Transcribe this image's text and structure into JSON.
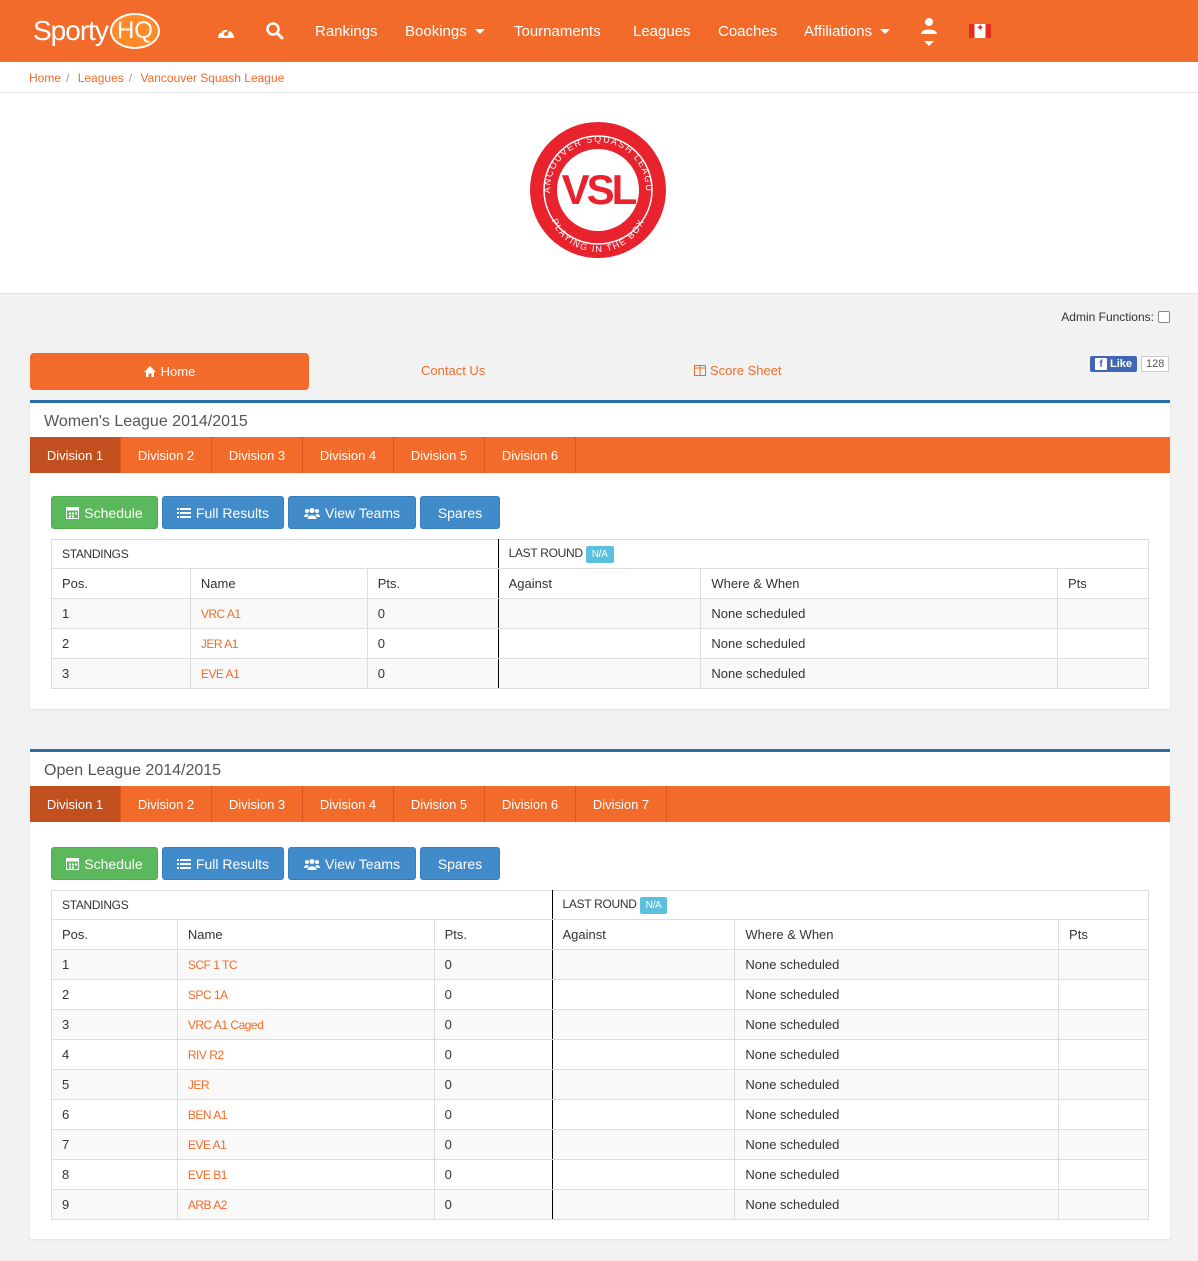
{
  "nav": {
    "logo_text": "Sporty",
    "logo_hq": "HQ",
    "items": [
      {
        "label": "Rankings"
      },
      {
        "label": "Bookings"
      },
      {
        "label": "Tournaments"
      },
      {
        "label": "Leagues"
      },
      {
        "label": "Coaches"
      },
      {
        "label": "Affiliations"
      }
    ]
  },
  "breadcrumb": [
    "Home",
    "Leagues",
    "Vancouver Squash League"
  ],
  "banner": {
    "logo_main": "VSL",
    "logo_ring_top": "VANCOUVER SQUASH LEAGUE",
    "logo_ring_bottom": "PLAYING IN THE BOX"
  },
  "admin_label": "Admin Functions:",
  "subnav": {
    "home": "Home",
    "contact": "Contact Us",
    "score_sheet": "Score Sheet"
  },
  "facebook": {
    "like": "Like",
    "count": "128"
  },
  "buttons": {
    "schedule": "Schedule",
    "full_results": "Full Results",
    "view_teams": "View Teams",
    "spares": "Spares"
  },
  "headers": {
    "standings": "STANDINGS",
    "last_round": "LAST ROUND",
    "na": "N/A",
    "pos": "Pos.",
    "name": "Name",
    "pts": "Pts.",
    "against": "Against",
    "where_when": "Where & When",
    "pts2": "Pts"
  },
  "leagues": [
    {
      "title": "Women's League 2014/2015",
      "tabs": [
        "Division 1",
        "Division 2",
        "Division 3",
        "Division 4",
        "Division 5",
        "Division 6"
      ],
      "rows": [
        {
          "pos": "1",
          "name": "VRC A1",
          "pts": "0",
          "where": "None scheduled"
        },
        {
          "pos": "2",
          "name": "JER A1",
          "pts": "0",
          "where": "None scheduled"
        },
        {
          "pos": "3",
          "name": "EVE A1",
          "pts": "0",
          "where": "None scheduled"
        }
      ]
    },
    {
      "title": "Open League 2014/2015",
      "tabs": [
        "Division 1",
        "Division 2",
        "Division 3",
        "Division 4",
        "Division 5",
        "Division 6",
        "Division 7"
      ],
      "rows": [
        {
          "pos": "1",
          "name": "SCF 1 TC",
          "pts": "0",
          "where": "None scheduled"
        },
        {
          "pos": "2",
          "name": "SPC 1A",
          "pts": "0",
          "where": "None scheduled"
        },
        {
          "pos": "3",
          "name": "VRC A1 Caged",
          "pts": "0",
          "where": "None scheduled"
        },
        {
          "pos": "4",
          "name": "RIV R2",
          "pts": "0",
          "where": "None scheduled"
        },
        {
          "pos": "5",
          "name": "JER",
          "pts": "0",
          "where": "None scheduled"
        },
        {
          "pos": "6",
          "name": "BEN A1",
          "pts": "0",
          "where": "None scheduled"
        },
        {
          "pos": "7",
          "name": "EVE A1",
          "pts": "0",
          "where": "None scheduled"
        },
        {
          "pos": "8",
          "name": "EVE B1",
          "pts": "0",
          "where": "None scheduled"
        },
        {
          "pos": "9",
          "name": "ARB A2",
          "pts": "0",
          "where": "None scheduled"
        }
      ]
    }
  ],
  "colors": {
    "brand": "#f26b2a",
    "active_tab": "#c24f1e",
    "panel_border": "#2d6ea6",
    "green": "#5cb85c",
    "blue": "#428bca",
    "info": "#5bc0de"
  }
}
